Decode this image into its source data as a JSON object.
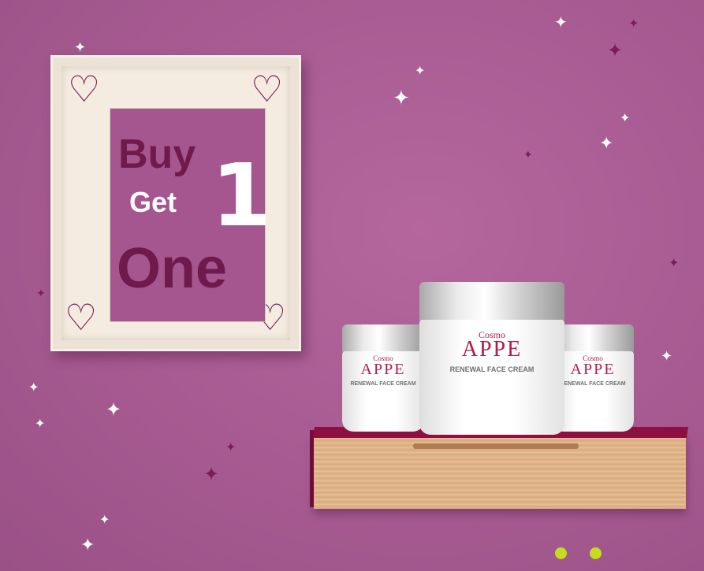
{
  "poster": {
    "word_buy": "Buy",
    "word_get": "Get",
    "numeral": "1",
    "word_one": "One"
  },
  "product": {
    "brand_prefix": "Cosmo",
    "brand_name": "APPE",
    "name": "RENEWAL FACE CREAM"
  },
  "icons": {
    "frame_corner": "heart-outline-icon",
    "sparkle": "four-point-star-icon"
  },
  "carousel": {
    "dot_count": 2,
    "dot_color": "#c6dd1e"
  },
  "colors": {
    "background": "#a65a91",
    "poster": "#a6568f",
    "accent_dark": "#6e1a4c",
    "brand_red": "#b31a47",
    "shelf_top": "#8e0f42",
    "shelf_wood": "#e3b88f"
  }
}
